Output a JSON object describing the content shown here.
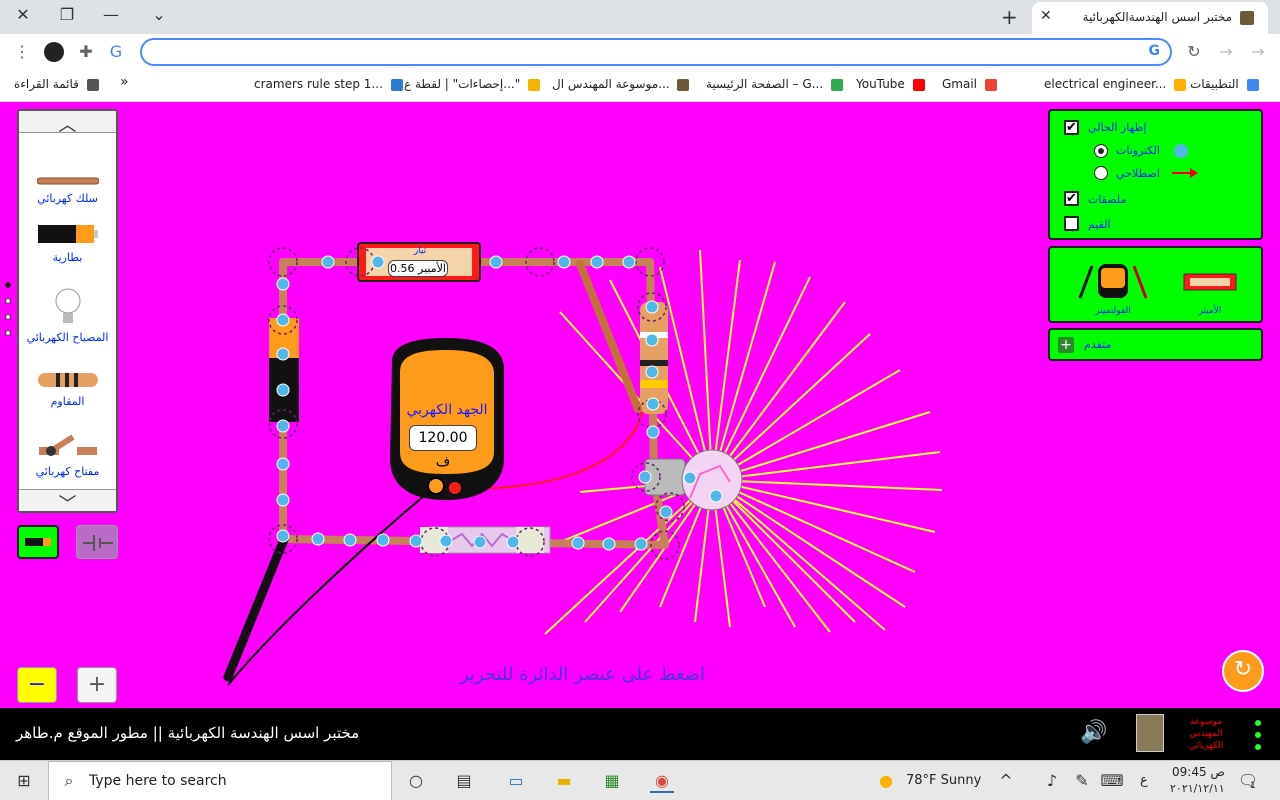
{
  "browser": {
    "tab_title": "مختبر اسس الهندسةالكهربائية",
    "tab_close": "✕",
    "new_tab": "+",
    "window_controls": {
      "close": "✕",
      "restore": "❐",
      "minimize": "—",
      "menu": "⌄"
    },
    "omnibox_value": "",
    "google_letter": "G"
  },
  "bookmarks": [
    {
      "label": "التطبيقات",
      "color": "#4285f4"
    },
    {
      "label": "electrical engineer...",
      "color": "#ffb000"
    },
    {
      "label": "Gmail",
      "color": "#ea4335"
    },
    {
      "label": "YouTube",
      "color": "#ff0000"
    },
    {
      "label": "الصفحة الرئيسية – G...",
      "color": "#34a853"
    },
    {
      "label": "موسوعة المهندس ال...",
      "color": "#6b5a3a"
    },
    {
      "label": "إحصاءات\" | لقطة ع...\"",
      "color": "#f4b400"
    },
    {
      "label": "cramers rule step 1...",
      "color": "#2b7bd3"
    },
    {
      "label": "قائمة القراءة",
      "color": "#555555"
    }
  ],
  "bookmarks_more": "»",
  "toolbox": {
    "items": [
      {
        "label": "سلك كهربائي",
        "icon": "wire-icon"
      },
      {
        "label": "بطارية",
        "icon": "battery-icon"
      },
      {
        "label": "المصباح الكهربائي",
        "icon": "bulb-icon"
      },
      {
        "label": "المقاوم",
        "icon": "resistor-icon"
      },
      {
        "label": "مفتاح كهربائي",
        "icon": "switch-icon"
      }
    ],
    "up_arrow": "︿",
    "down_arrow": "﹀"
  },
  "controls": {
    "show_current_label": "إظهار الحالي",
    "show_current_checked": true,
    "electrons_label": "الكترونات",
    "electrons_selected": true,
    "conventional_label": "اصطلاحي",
    "conventional_selected": false,
    "labels_label": "ملصقات",
    "labels_checked": true,
    "values_label": "القيم",
    "values_checked": false,
    "check_mark": "✔"
  },
  "tools_panel": {
    "voltmeter_label": "الفولتميتر",
    "ammeter_label": "الأميتر"
  },
  "advanced_label": "متقدم",
  "advanced_icon": "+",
  "circuit": {
    "ammeter_title": "تيار",
    "ammeter_reading": "0.56 الأمبير",
    "voltmeter_title": "الجهد الكهربي",
    "voltmeter_reading": "120.00 ف"
  },
  "hint": "اضغط على عنصر الدائرة للتحرير",
  "zoom_out": "−",
  "zoom_in": "+",
  "reset_icon": "↻",
  "footer": {
    "title": "مختبر اسس الهندسة الكهربائية || مطور الموقع م.طاهر",
    "brand": "موسوعة المهندس الكهربائي",
    "speaker": "🔊"
  },
  "taskbar": {
    "search_placeholder": "Type here to search",
    "weather": "78°F  Sunny",
    "lang": "ع",
    "time": "09:45 ص",
    "date": "٢٠٢١/١٢/١١",
    "notifications": "1"
  },
  "colors": {
    "sim_bg": "#ff00ff",
    "panel_green": "#00ff00",
    "label_blue": "#0026ff",
    "hint_color": "#4a33d8",
    "wire": "#c8805a",
    "electron": "#4fb8e8"
  }
}
